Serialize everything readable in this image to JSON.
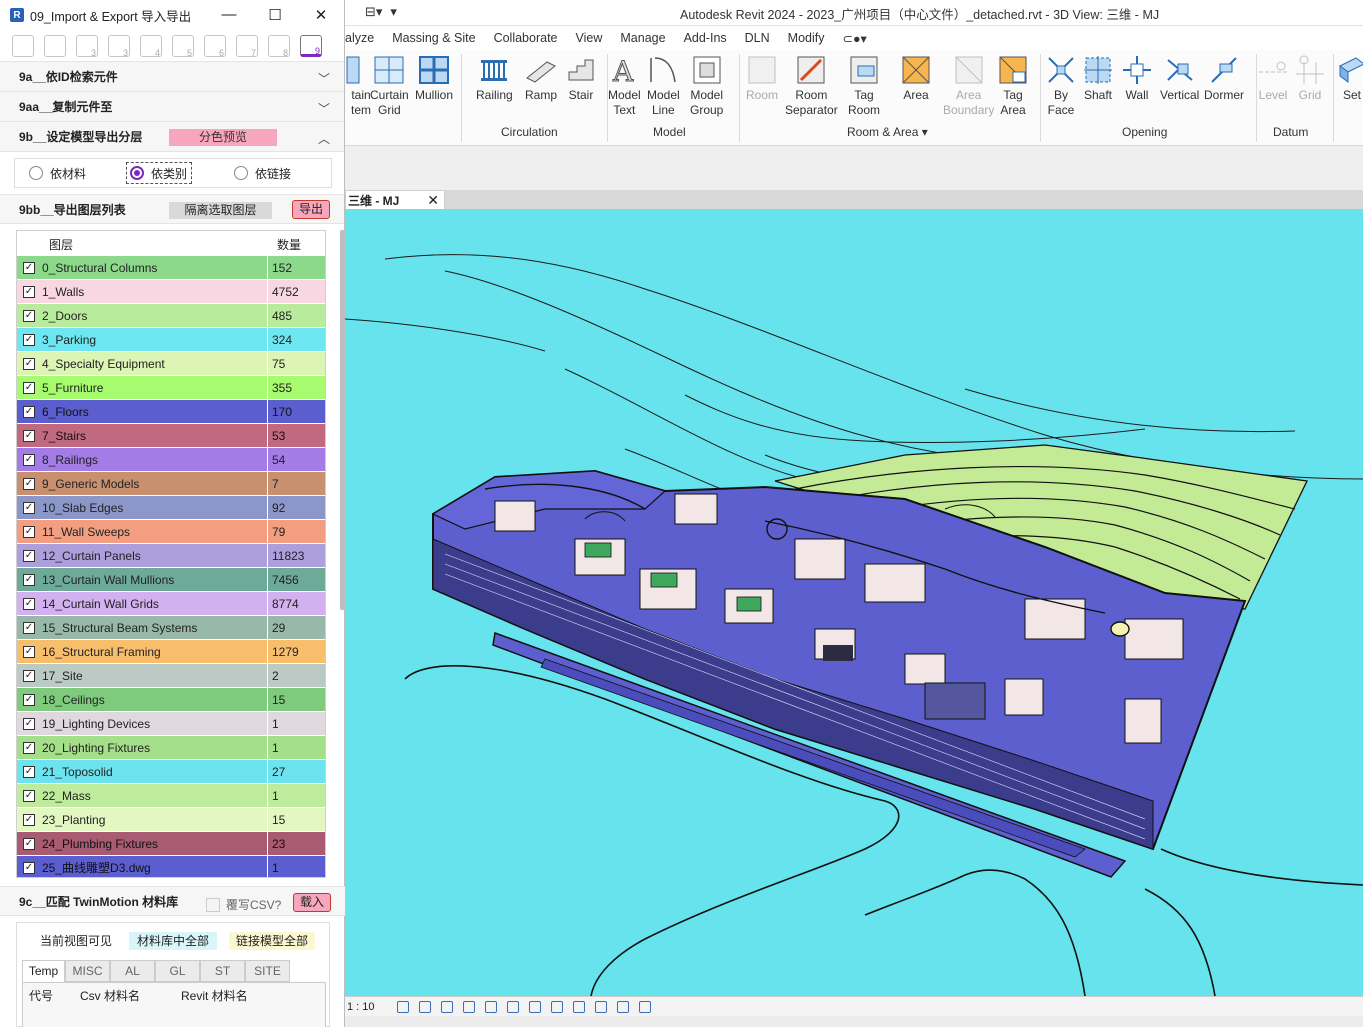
{
  "revit": {
    "title": "Autodesk Revit 2024 - 2023_广州项目（中心文件）_detached.rvt - 3D View: 三维 - MJ",
    "menu": [
      "alyze",
      "Massing & Site",
      "Collaborate",
      "View",
      "Manage",
      "Add-Ins",
      "DLN",
      "Modify",
      "⊂●▾"
    ],
    "ribbon_buttons": {
      "curtain_system": "tain\ntem",
      "curtain_grid": "Curtain\nGrid",
      "mullion": "Mullion",
      "railing": "Railing",
      "ramp": "Ramp",
      "stair": "Stair",
      "model_text": "Model\nText",
      "model_line": "Model\nLine",
      "model_group": "Model\nGroup",
      "room": "Room",
      "room_separator": "Room\nSeparator",
      "tag_room": "Tag\nRoom",
      "area": "Area",
      "area_boundary": "Area\nBoundary",
      "tag_area": "Tag\nArea",
      "by_face": "By\nFace",
      "shaft": "Shaft",
      "wall": "Wall",
      "vertical": "Vertical",
      "dormer": "Dormer",
      "level": "Level",
      "grid": "Grid",
      "set": "Set"
    },
    "panels": {
      "circulation": "Circulation",
      "model": "Model",
      "room_area": "Room & Area ▾",
      "opening": "Opening",
      "datum": "Datum"
    },
    "view_tab": "三维 - MJ",
    "scale": "1 : 10"
  },
  "plugin": {
    "title": "09_Import & Export 导入导出",
    "sections": {
      "s9a": "9a__依ID检索元件",
      "s9aa": "9aa__复制元件至",
      "s9b": "9b__设定模型导出分层",
      "s9b_badge": "分色预览",
      "s9bb": "9bb__导出图层列表",
      "s9bb_isolate": "隔离选取图层",
      "s9bb_export": "导出",
      "s9c": "9c__匹配 TwinMotion 材料库",
      "s9c_csv": "覆写CSV?",
      "s9c_load": "载入"
    },
    "radios": {
      "material": "依材料",
      "category": "依类别",
      "link": "依链接"
    },
    "layer_table": {
      "headers": {
        "layer": "图层",
        "count": "数量"
      },
      "rows": [
        {
          "name": "0_Structural Columns",
          "count": "152",
          "color": "#8cd98c"
        },
        {
          "name": "1_Walls",
          "count": "4752",
          "color": "#f8d7e2"
        },
        {
          "name": "2_Doors",
          "count": "485",
          "color": "#b8ec9c"
        },
        {
          "name": "3_Parking",
          "count": "324",
          "color": "#6ee6f2"
        },
        {
          "name": "4_Specialty Equipment",
          "count": "75",
          "color": "#dcf4b4"
        },
        {
          "name": "5_Furniture",
          "count": "355",
          "color": "#a6fb6e"
        },
        {
          "name": "6_Floors",
          "count": "170",
          "color": "#5b5ecf"
        },
        {
          "name": "7_Stairs",
          "count": "53",
          "color": "#c16a7f"
        },
        {
          "name": "8_Railings",
          "count": "54",
          "color": "#a37ce6"
        },
        {
          "name": "9_Generic Models",
          "count": "7",
          "color": "#c8906f"
        },
        {
          "name": "10_Slab Edges",
          "count": "92",
          "color": "#8c97c9"
        },
        {
          "name": "11_Wall Sweeps",
          "count": "79",
          "color": "#f39e80"
        },
        {
          "name": "12_Curtain Panels",
          "count": "11823",
          "color": "#ad9fdc"
        },
        {
          "name": "13_Curtain Wall Mullions",
          "count": "7456",
          "color": "#6eaa98"
        },
        {
          "name": "14_Curtain Wall Grids",
          "count": "8774",
          "color": "#d3b0f0"
        },
        {
          "name": "15_Structural Beam Systems",
          "count": "29",
          "color": "#98b8aa"
        },
        {
          "name": "16_Structural Framing",
          "count": "1279",
          "color": "#f9be6c"
        },
        {
          "name": "17_Site",
          "count": "2",
          "color": "#bccac6"
        },
        {
          "name": "18_Ceilings",
          "count": "15",
          "color": "#7fcb7e"
        },
        {
          "name": "19_Lighting Devices",
          "count": "1",
          "color": "#e0d7df"
        },
        {
          "name": "20_Lighting Fixtures",
          "count": "1",
          "color": "#a4e08a"
        },
        {
          "name": "21_Toposolid",
          "count": "27",
          "color": "#6de3ef"
        },
        {
          "name": "22_Mass",
          "count": "1",
          "color": "#bfeb9d"
        },
        {
          "name": "23_Planting",
          "count": "15",
          "color": "#e3f7c3"
        },
        {
          "name": "24_Plumbing Fixtures",
          "count": "23",
          "color": "#a95b73"
        },
        {
          "name": "25_曲线雕塑D3.dwg",
          "count": "1",
          "color": "#5b5ecf"
        }
      ]
    },
    "tm": {
      "btn_current": "当前视图可见",
      "btn_library": "材料库中全部",
      "btn_linked": "链接模型全部",
      "tabs": [
        "Temp",
        "MISC",
        "AL",
        "GL",
        "ST",
        "SITE"
      ],
      "cols": {
        "code": "代号",
        "csv": "Csv 材料名",
        "revit": "Revit 材料名"
      }
    }
  }
}
